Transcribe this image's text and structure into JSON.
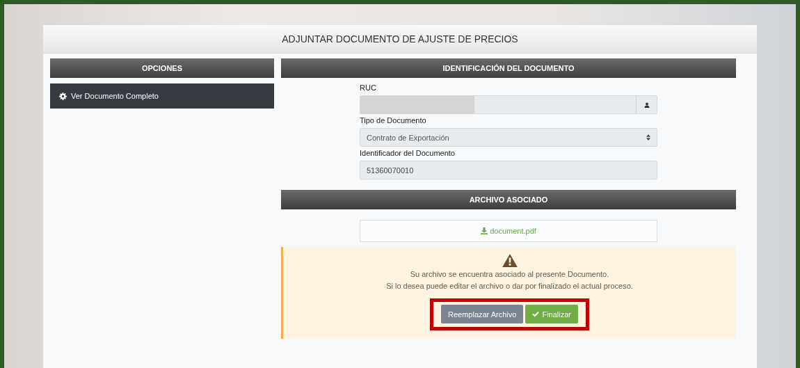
{
  "panel": {
    "title": "ADJUNTAR DOCUMENTO DE AJUSTE DE PRECIOS"
  },
  "sidebar": {
    "header": "OPCIONES",
    "items": [
      {
        "label": "Ver Documento Completo",
        "selected": true
      }
    ]
  },
  "identification": {
    "header": "IDENTIFICACIÓN DEL DOCUMENTO",
    "fields": [
      {
        "kind": "input-addon",
        "label": "RUC",
        "redacted": true
      },
      {
        "kind": "select",
        "label": "Tipo de Documento",
        "value": "Contrato de Exportación"
      },
      {
        "kind": "input",
        "label": "Identificador del Documento",
        "value": "51360070010"
      }
    ]
  },
  "attachment": {
    "header": "ARCHIVO ASOCIADO",
    "file_link": "document.pdf"
  },
  "alert": {
    "lines": [
      "Su archivo se encuentra asociado al presente Documento.",
      "Si lo desea puede editar el archivo o dar por finalizado el actual proceso."
    ],
    "buttons": [
      {
        "kind": "secondary",
        "label": "Reemplazar Archivo"
      },
      {
        "kind": "success",
        "label": "Finalizar"
      }
    ],
    "highlighted": true
  }
}
